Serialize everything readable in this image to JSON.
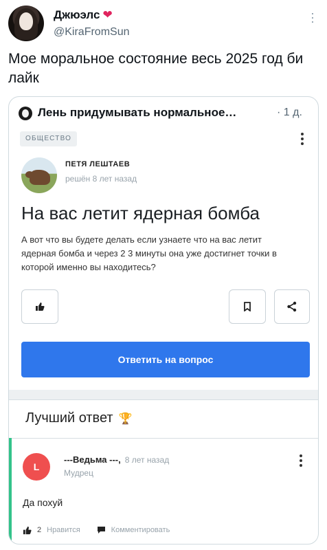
{
  "tweet": {
    "display_name": "Джюэлс",
    "handle": "@KiraFromSun",
    "text": "Мое моральное состояние весь 2025 год би лайк"
  },
  "quote": {
    "author": "Лень придумывать нормальное…",
    "time": "· 1 д.",
    "card": {
      "category": "ОБЩЕСТВО",
      "author_name": "ПЕТЯ ЛЕШТАЕВ",
      "author_meta": "решён 8 лет назад",
      "title": "На вас летит ядерная бомба",
      "body": "А вот что вы будете делать если узнаете что на вас летит ядерная бомба и через 2 3 минуты она уже достигнет точки в которой именно вы находитесь?",
      "answer_button": "Ответить на вопрос",
      "best_answer_label": "Лучший ответ",
      "answer": {
        "avatar_letter": "L",
        "author": "---Ведьма ---,",
        "time": "8 лет назад",
        "rank": "Мудрец",
        "text": "Да похуй",
        "likes": "2",
        "like_label": "Нравится",
        "comment_label": "Комментировать"
      }
    }
  },
  "colors": {
    "primary_button": "#2f77ec",
    "accent": "#33c38a",
    "avatar_red": "#ef4f4f"
  },
  "icons": [
    "heart-icon",
    "more-icon",
    "thumbs-up-icon",
    "bookmark-icon",
    "share-icon",
    "trophy-icon",
    "comment-icon"
  ]
}
